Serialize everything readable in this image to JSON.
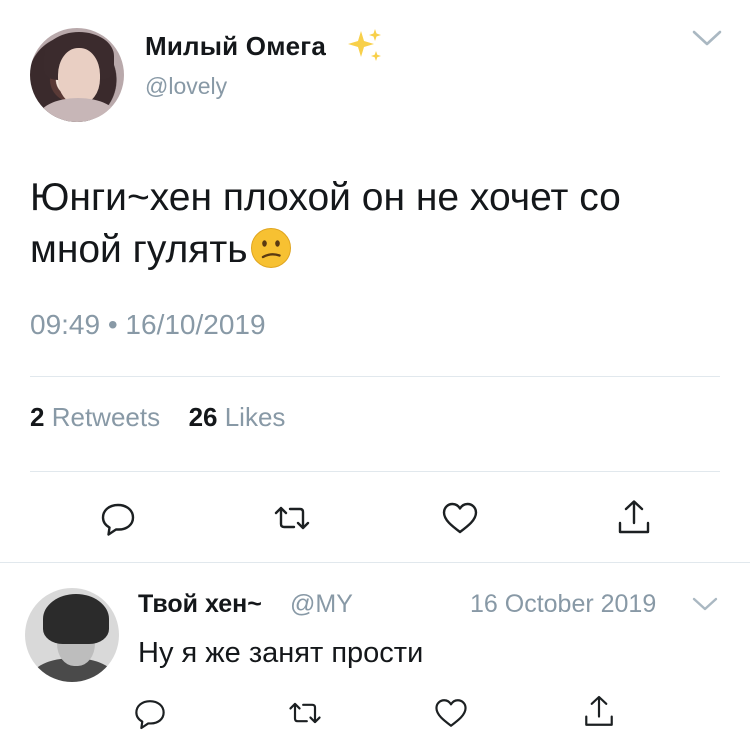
{
  "tweet": {
    "author": {
      "display_name": "Милый Омега",
      "handle": "@lovely",
      "avatar": "avatar-photo",
      "badge_icon": "sparkles-icon"
    },
    "text": "Юнги~хен плохой он не хочет со мной гулять",
    "emoji": "confused-face-emoji",
    "timestamp": "09:49 • 16/10/2019",
    "stats": {
      "retweets_count": "2",
      "retweets_label": "Retweets",
      "likes_count": "26",
      "likes_label": "Likes"
    },
    "actions": [
      "reply-icon",
      "retweet-icon",
      "like-icon",
      "share-icon"
    ]
  },
  "reply": {
    "author": {
      "display_name": "Твой хен~",
      "handle": "@MY",
      "avatar": "avatar-photo"
    },
    "date": "16 October 2019",
    "text": "Ну я же занят прости",
    "actions": [
      "reply-icon",
      "retweet-icon",
      "like-icon",
      "share-icon"
    ]
  },
  "colors": {
    "text_primary": "#14171a",
    "text_secondary": "#8899a6",
    "divider": "#e1e8ed",
    "emoji_yellow": "#f7c132",
    "sparkle_yellow": "#f8d04a"
  }
}
